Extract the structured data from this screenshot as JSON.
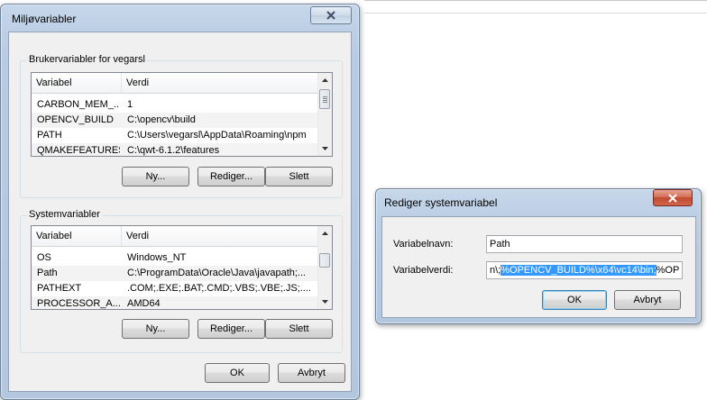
{
  "env_dialog": {
    "title": "Miljøvariabler",
    "user_group": {
      "label": "Brukervariabler for vegarsl",
      "columns": [
        "Variabel",
        "Verdi"
      ],
      "rows": [
        {
          "name": "CARBON_MEM_...",
          "value": "1"
        },
        {
          "name": "OPENCV_BUILD",
          "value": "C:\\opencv\\build"
        },
        {
          "name": "PATH",
          "value": "C:\\Users\\vegarsl\\AppData\\Roaming\\npm"
        },
        {
          "name": "QMAKEFEATURES",
          "value": "C:\\qwt-6.1.2\\features"
        }
      ],
      "buttons": {
        "new": "Ny...",
        "edit": "Rediger...",
        "delete": "Slett"
      }
    },
    "system_group": {
      "label": "Systemvariabler",
      "columns": [
        "Variabel",
        "Verdi"
      ],
      "rows": [
        {
          "name": "OS",
          "value": "Windows_NT"
        },
        {
          "name": "Path",
          "value": "C:\\ProgramData\\Oracle\\Java\\javapath;..."
        },
        {
          "name": "PATHEXT",
          "value": ".COM;.EXE;.BAT;.CMD;.VBS;.VBE;.JS;...."
        },
        {
          "name": "PROCESSOR_A...",
          "value": "AMD64"
        }
      ],
      "buttons": {
        "new": "Ny...",
        "edit": "Rediger...",
        "delete": "Slett"
      }
    },
    "ok": "OK",
    "cancel": "Avbryt"
  },
  "edit_dialog": {
    "title": "Rediger systemvariabel",
    "name_label": "Variabelnavn:",
    "name_value": "Path",
    "value_label": "Variabelverdi:",
    "value_prefix": "n\\;",
    "value_selected": "%OPENCV_BUILD%\\x64\\vc14\\bin;",
    "value_suffix": "%OP",
    "ok": "OK",
    "cancel": "Avbryt"
  },
  "colors": {
    "selection": "#3399ff",
    "client_bg": "#f0f0f0",
    "frame": "#bdd0e6"
  },
  "icons": [
    "close-icon",
    "scroll-up-icon",
    "scroll-down-icon"
  ]
}
